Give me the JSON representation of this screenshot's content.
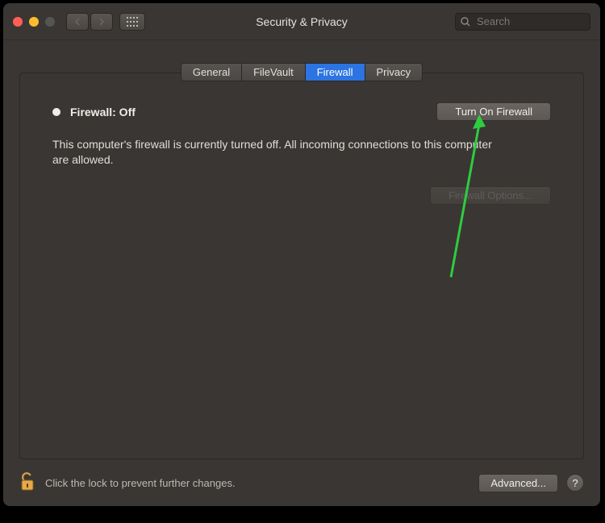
{
  "window": {
    "title": "Security & Privacy",
    "search_placeholder": "Search"
  },
  "tabs": {
    "general": "General",
    "filevault": "FileVault",
    "firewall": "Firewall",
    "privacy": "Privacy"
  },
  "firewall": {
    "status_label": "Firewall: Off",
    "turn_on_label": "Turn On Firewall",
    "description": "This computer's firewall is currently turned off. All incoming connections to this computer are allowed.",
    "options_label": "Firewall Options..."
  },
  "footer": {
    "lock_text": "Click the lock to prevent further changes.",
    "advanced_label": "Advanced...",
    "help_label": "?"
  }
}
